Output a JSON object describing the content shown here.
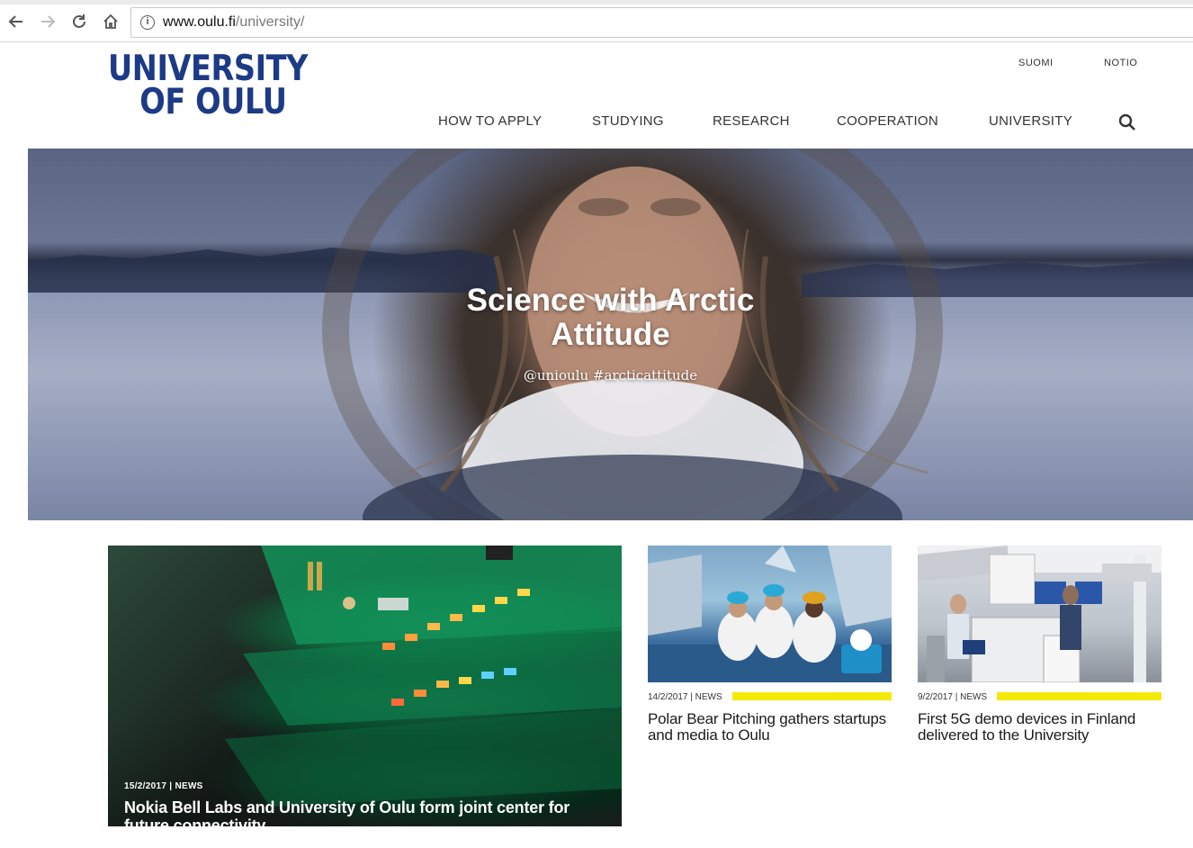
{
  "browser": {
    "url_host": "www.oulu.fi",
    "url_path": "/university/"
  },
  "header": {
    "logo_line1": "UNIVERSITY",
    "logo_line2": "OF OULU",
    "lang_links": [
      "SUOMI",
      "NOTIO"
    ],
    "nav": [
      "HOW TO APPLY",
      "STUDYING",
      "RESEARCH",
      "COOPERATION",
      "UNIVERSITY"
    ]
  },
  "hero": {
    "title_line1": "Science with Arctic",
    "title_line2": "Attitude",
    "tagline": "@unioulu #arcticattitude"
  },
  "news": [
    {
      "date": "15/2/2017",
      "category": "NEWS",
      "title": "Nokia Bell Labs and University of Oulu form joint center for future connectivity"
    },
    {
      "date": "14/2/2017",
      "category": "NEWS",
      "title": "Polar Bear Pitching gathers startups and media to Oulu"
    },
    {
      "date": "9/2/2017",
      "category": "NEWS",
      "title": "First 5G demo devices in Finland delivered to the University"
    }
  ],
  "colors": {
    "brand": "#1c3a86",
    "accent_bar": "#f3ea0a"
  }
}
